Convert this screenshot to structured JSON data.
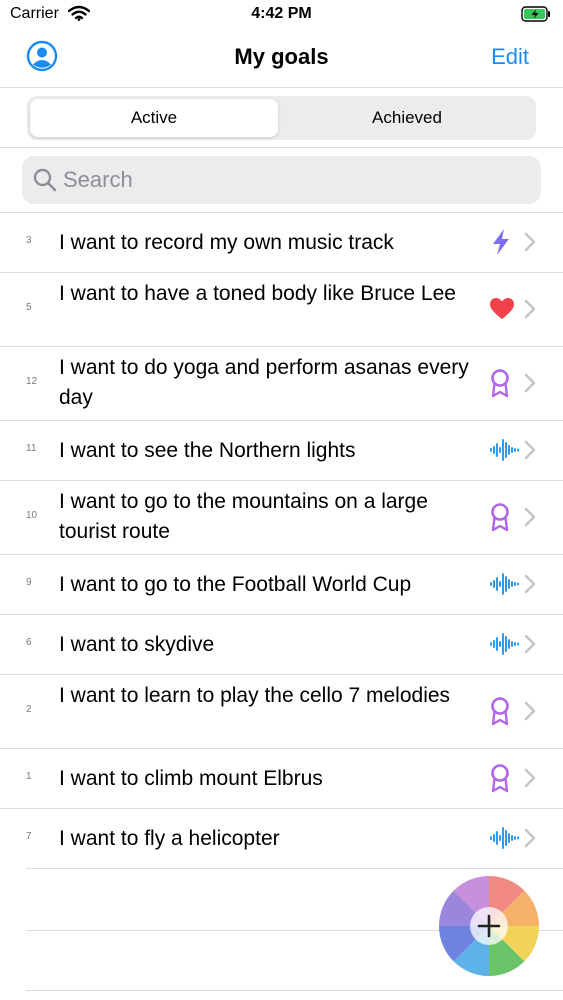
{
  "status_bar": {
    "carrier": "Carrier",
    "time": "4:42 PM"
  },
  "nav": {
    "title": "My goals",
    "edit_label": "Edit",
    "accent_color": "#1a8cf0"
  },
  "segments": {
    "active": "Active",
    "achieved": "Achieved",
    "selected": "Active"
  },
  "search": {
    "placeholder": "Search"
  },
  "goals": [
    {
      "number": "3",
      "text": "I want to record my own music track",
      "icon": "lightning-icon"
    },
    {
      "number": "5",
      "text": "I want to have a toned body like Bruce Lee",
      "icon": "heart-icon"
    },
    {
      "number": "12",
      "text": "I want to do yoga and perform asanas every day",
      "icon": "ribbon-icon"
    },
    {
      "number": "11",
      "text": "I want to see the Northern lights",
      "icon": "waveform-icon"
    },
    {
      "number": "10",
      "text": "I want to go to the mountains on a large tourist route",
      "icon": "ribbon-icon"
    },
    {
      "number": "9",
      "text": "I want to go to the Football World Cup",
      "icon": "waveform-icon"
    },
    {
      "number": "6",
      "text": "I want to skydive",
      "icon": "waveform-icon"
    },
    {
      "number": "2",
      "text": "I want to learn to play the cello 7 melodies",
      "icon": "ribbon-icon"
    },
    {
      "number": "1",
      "text": "I want to climb mount Elbrus",
      "icon": "ribbon-icon"
    },
    {
      "number": "7",
      "text": "I want to fly a helicopter",
      "icon": "waveform-icon"
    }
  ],
  "icon_colors": {
    "lightning-icon": "#7a6ff0",
    "heart-icon": "#f0424a",
    "ribbon-icon": "#b066e6",
    "waveform-icon": "#2f9bf0"
  }
}
